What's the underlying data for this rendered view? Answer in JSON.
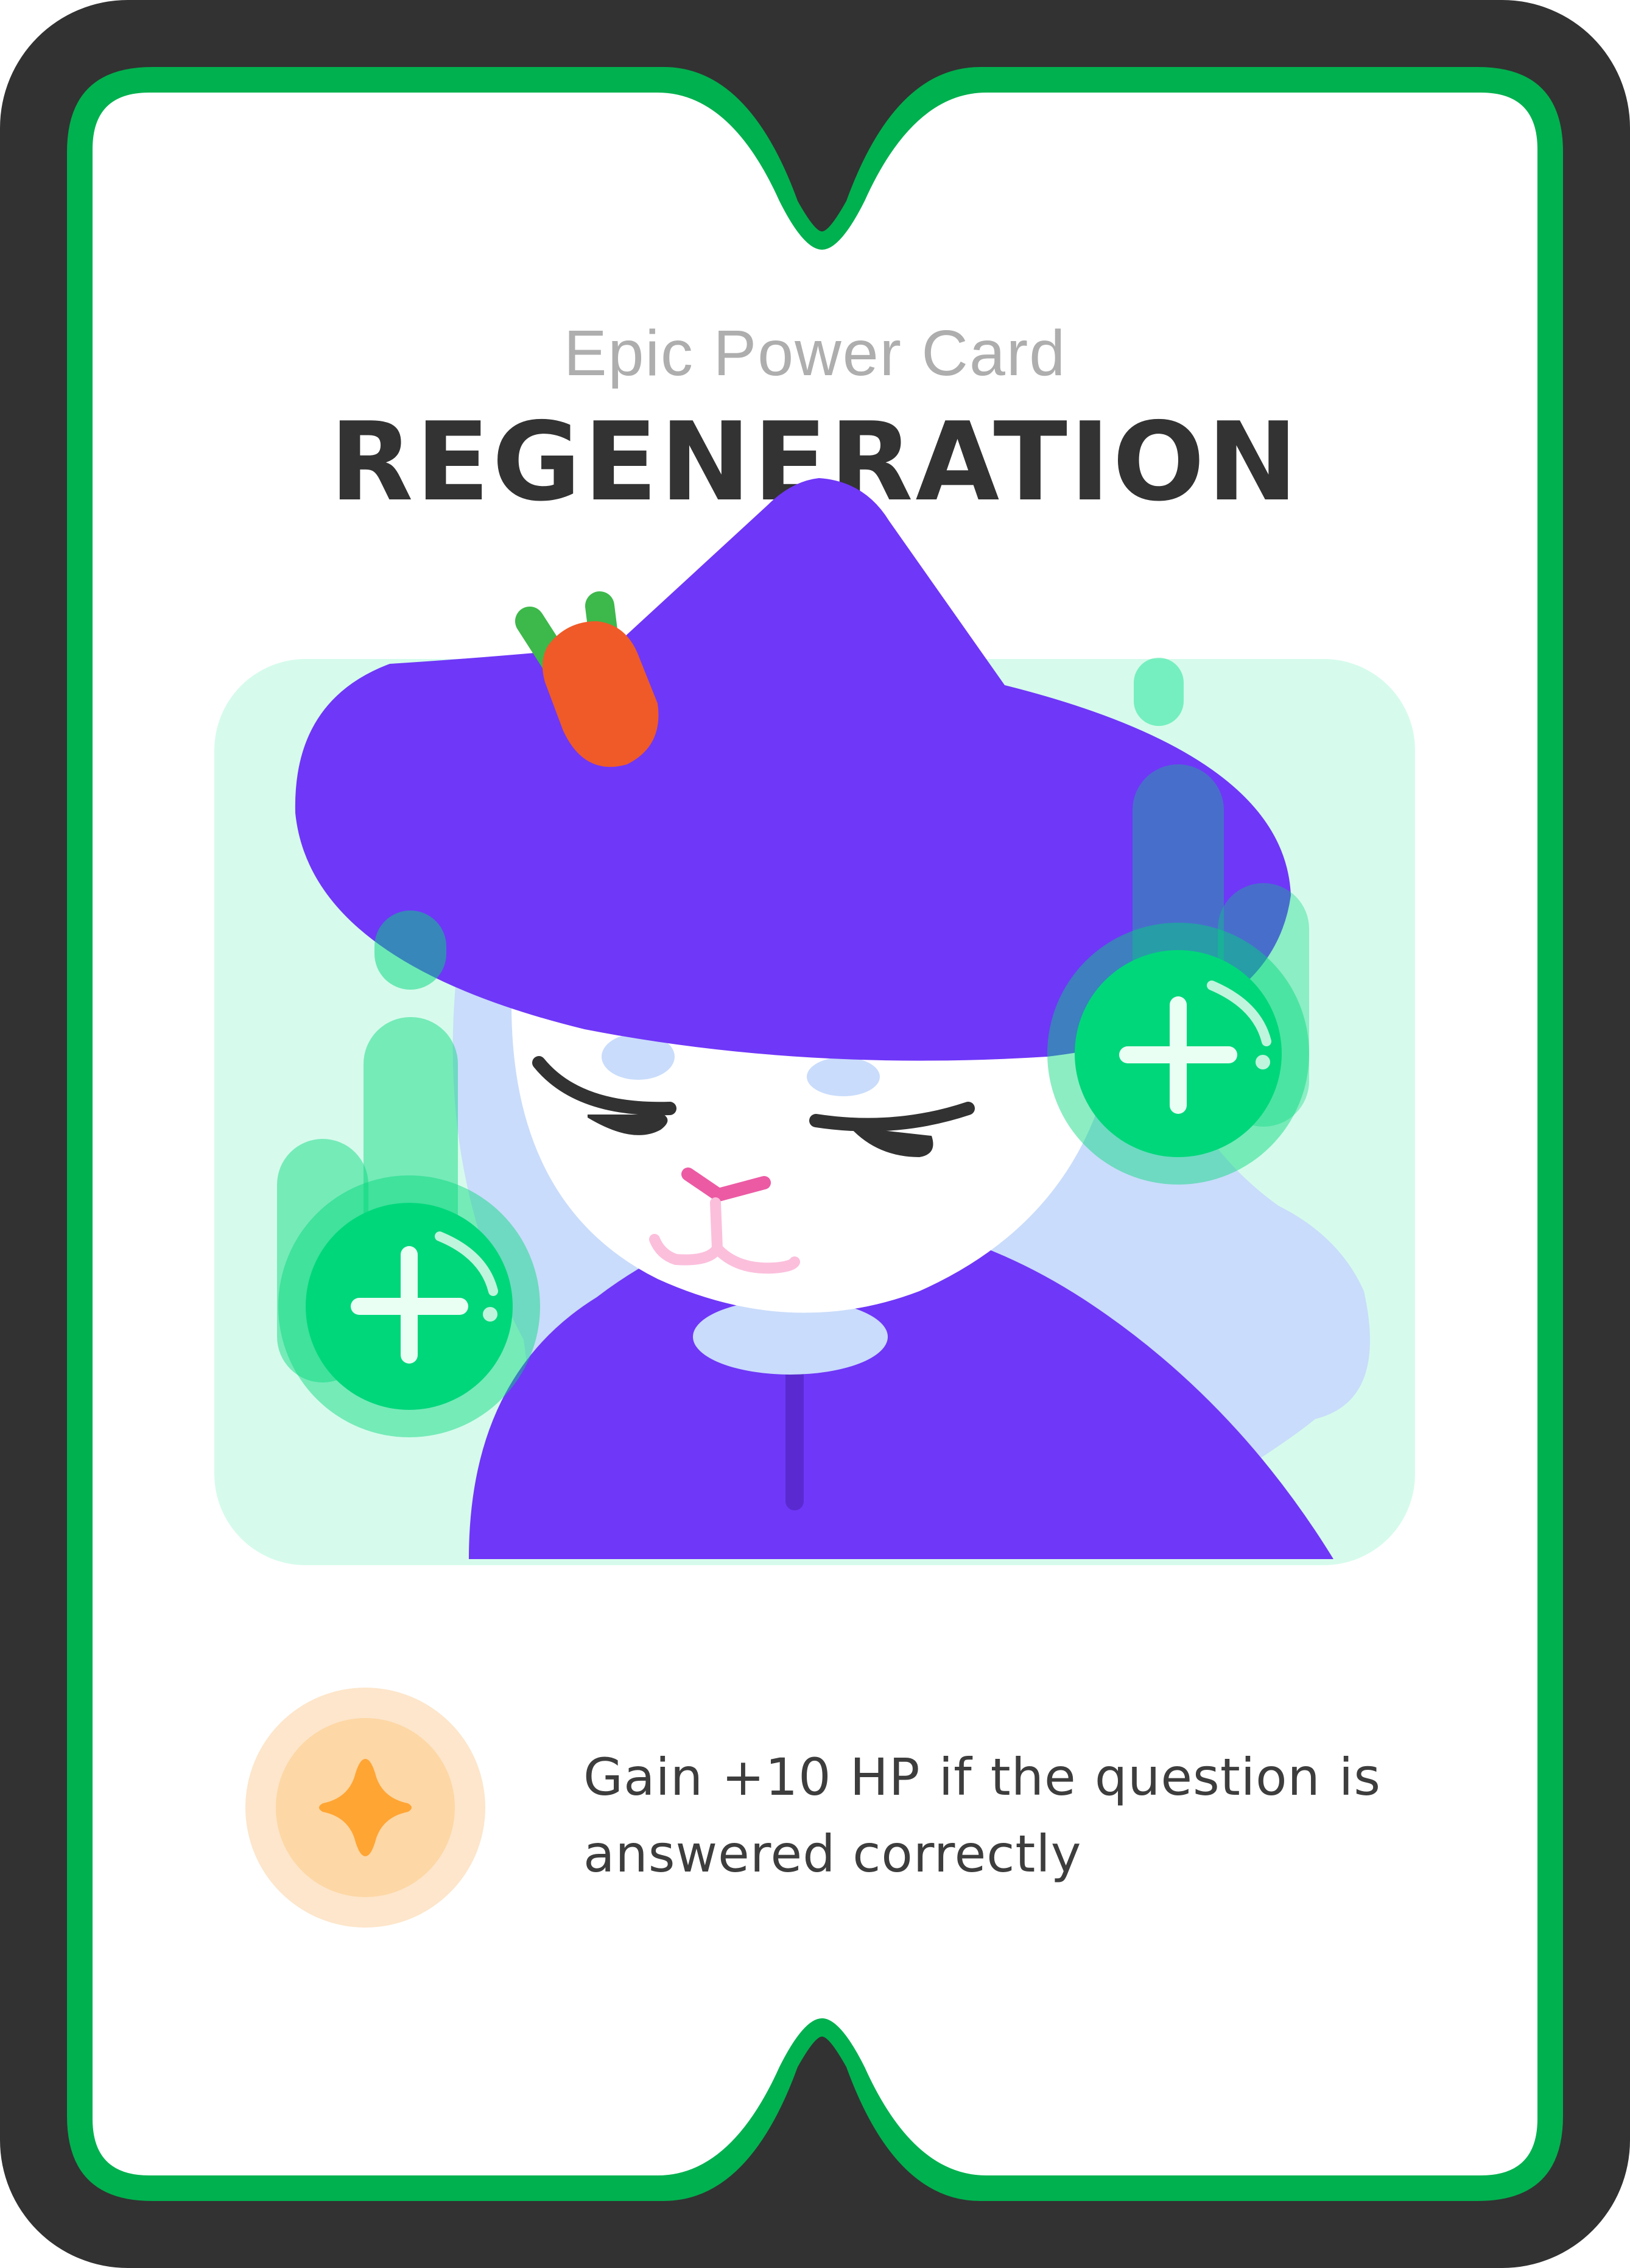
{
  "card": {
    "rarity_label": "Epic Power Card",
    "name": "REGENERATION",
    "effect_text": "Gain +10 HP if the question is answered correctly",
    "effect_icon": "sparkle-icon",
    "illustration": "witch-bunny-with-heal-plus-icons"
  },
  "colors": {
    "frame_dark": "#323232",
    "frame_accent": "#00b14f",
    "art_background": "#d6fbec",
    "hat_purple": "#6f37f8",
    "heal_green": "#00d77b",
    "badge_orange": "#ffa534"
  }
}
